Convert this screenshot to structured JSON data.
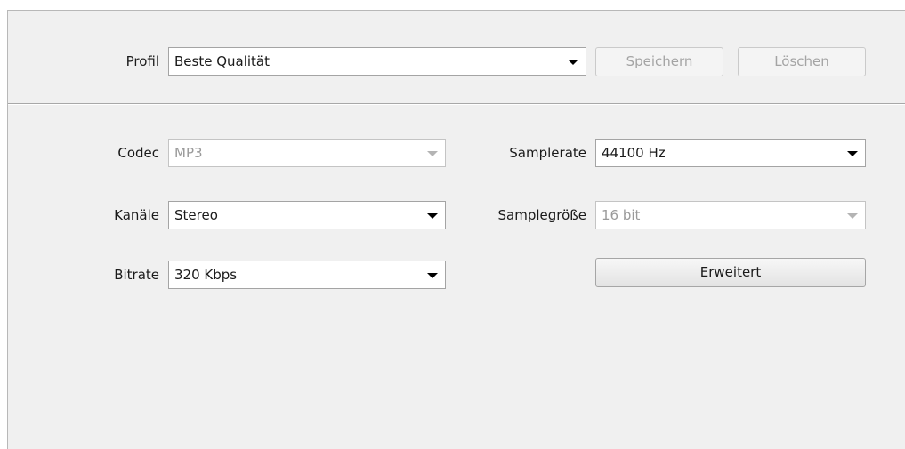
{
  "profile": {
    "label": "Profil",
    "value": "Beste Qualität",
    "save_label": "Speichern",
    "delete_label": "Löschen"
  },
  "settings": {
    "codec": {
      "label": "Codec",
      "value": "MP3",
      "enabled": false
    },
    "channels": {
      "label": "Kanäle",
      "value": "Stereo",
      "enabled": true
    },
    "bitrate": {
      "label": "Bitrate",
      "value": "320 Kbps",
      "enabled": true
    },
    "samplerate": {
      "label": "Samplerate",
      "value": "44100 Hz",
      "enabled": true
    },
    "samplesize": {
      "label": "Samplegröße",
      "value": "16 bit",
      "enabled": false
    },
    "advanced_label": "Erweitert"
  }
}
